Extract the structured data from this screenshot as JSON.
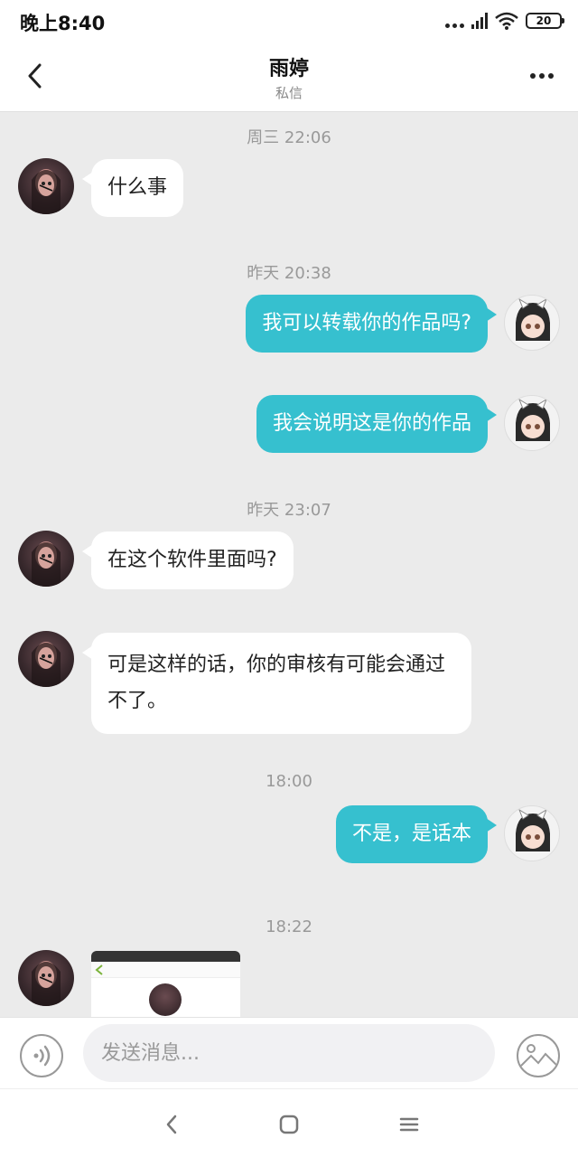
{
  "status_bar": {
    "time": "晚上8:40",
    "battery": "20"
  },
  "header": {
    "title": "雨婷",
    "subtitle": "私信"
  },
  "timestamps": [
    "周三 22:06",
    "昨天 20:38",
    "昨天 23:07",
    "18:00",
    "18:22"
  ],
  "messages": [
    {
      "side": "in",
      "text": "什么事"
    },
    {
      "side": "out",
      "text": "我可以转载你的作品吗?"
    },
    {
      "side": "out",
      "text": "我会说明这是你的作品"
    },
    {
      "side": "in",
      "text": "在这个软件里面吗?"
    },
    {
      "side": "in",
      "text": "可是这样的话，你的审核有可能会通过不了。"
    },
    {
      "side": "out",
      "text": "不是，是话本"
    }
  ],
  "input": {
    "placeholder": "发送消息..."
  },
  "colors": {
    "accent": "#36c0cf",
    "background": "#ebebeb"
  },
  "icons": [
    "back-icon",
    "more-icon",
    "voice-icon",
    "image-icon",
    "nav-back-icon",
    "nav-home-icon",
    "nav-menu-icon"
  ]
}
